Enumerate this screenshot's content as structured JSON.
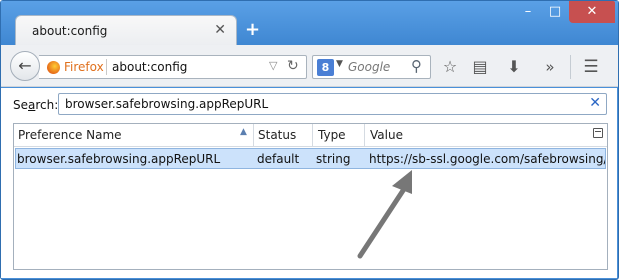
{
  "browser": {
    "tab_title": "about:config",
    "tab_close": "✕",
    "new_tab": "+",
    "window_controls": {
      "minimize": "–",
      "maximize": "□",
      "close": "✕"
    },
    "identity_label": "Firefox",
    "url": "about:config",
    "search_placeholder": "Google",
    "search_engine_icon": "google-g-icon"
  },
  "toolbar": {
    "icons": [
      "star-icon",
      "reading-list-icon",
      "download-icon",
      "overflow-chevron-icon",
      "hamburger-menu-icon"
    ]
  },
  "filter": {
    "label_pre": "Se",
    "label_underlined": "a",
    "label_post": "rch:",
    "value": "browser.safebrowsing.appRepURL",
    "clear_icon": "✕"
  },
  "table": {
    "columns": {
      "name": "Preference Name",
      "status": "Status",
      "type": "Type",
      "value": "Value"
    },
    "rows": [
      {
        "name": "browser.safebrowsing.appRepURL",
        "status": "default",
        "type": "string",
        "value": "https://sb-ssl.google.com/safebrowsing/cli..."
      }
    ]
  },
  "colors": {
    "window_frame": "#4a90d9",
    "selected_row": "#cce2fb",
    "firefox_label": "#e0701d",
    "annotation_arrow": "#777777"
  }
}
